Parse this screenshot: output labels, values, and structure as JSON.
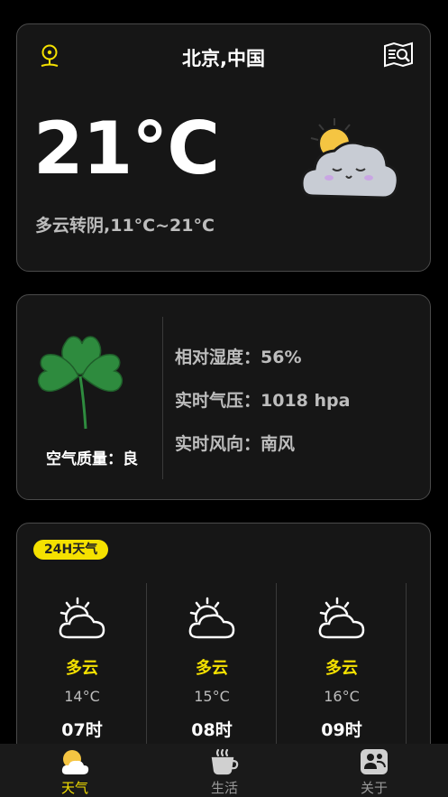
{
  "current": {
    "city": "北京,中国",
    "temperature": "21°C",
    "summary": "多云转阴,11°C~21°C",
    "location_icon": "location-pin-icon",
    "search_icon": "map-search-icon",
    "weather_icon": "cloud-sun-icon"
  },
  "air": {
    "quality_label": "空气质量：良",
    "humidity": "相对湿度：56%",
    "pressure": "实时气压：1018 hpa",
    "wind": "实时风向：南风",
    "icon": "clover-icon"
  },
  "hourly": {
    "badge": "24H天气",
    "items": [
      {
        "condition": "多云",
        "temp": "14°C",
        "time": "07时",
        "icon": "partly-cloudy-icon"
      },
      {
        "condition": "多云",
        "temp": "15°C",
        "time": "08时",
        "icon": "partly-cloudy-icon"
      },
      {
        "condition": "多云",
        "temp": "16°C",
        "time": "09时",
        "icon": "partly-cloudy-icon"
      }
    ]
  },
  "tabs": [
    {
      "label": "天气",
      "icon": "weather-tab-icon",
      "active": true
    },
    {
      "label": "生活",
      "icon": "coffee-cup-icon",
      "active": false
    },
    {
      "label": "关于",
      "icon": "users-icon",
      "active": false
    }
  ],
  "colors": {
    "accent": "#f5e100",
    "card_bg": "#161616",
    "card_border": "#4a4a4a",
    "clover_green": "#2e8b3e",
    "muted_text": "#bdbdbd"
  }
}
